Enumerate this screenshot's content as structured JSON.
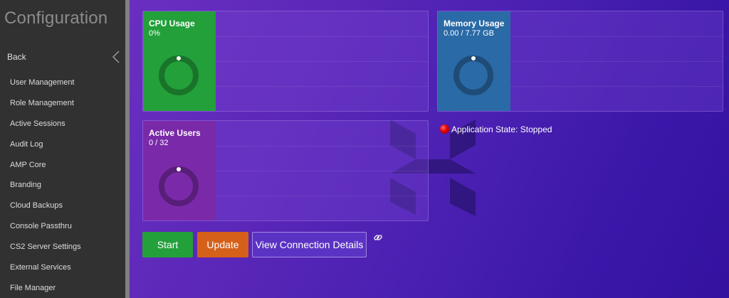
{
  "sidebar": {
    "title": "Configuration",
    "back_label": "Back",
    "items": [
      {
        "label": "User Management"
      },
      {
        "label": "Role Management"
      },
      {
        "label": "Active Sessions"
      },
      {
        "label": "Audit Log"
      },
      {
        "label": "AMP Core"
      },
      {
        "label": "Branding"
      },
      {
        "label": "Cloud Backups"
      },
      {
        "label": "Console Passthru"
      },
      {
        "label": "CS2 Server Settings"
      },
      {
        "label": "External Services"
      },
      {
        "label": "File Manager"
      }
    ]
  },
  "metrics": {
    "cpu": {
      "title": "CPU Usage",
      "value": "0%",
      "fraction": 0,
      "color": "#23a03a"
    },
    "memory": {
      "title": "Memory Usage",
      "value": "0.00 / 7.77 GB",
      "fraction": 0,
      "color": "#2a6aa6"
    },
    "users": {
      "title": "Active Users",
      "value": "0 / 32",
      "fraction": 0,
      "color": "#7a2aa8"
    }
  },
  "app_state": {
    "text": "Application State: Stopped",
    "color": "#e00000"
  },
  "actions": {
    "start_label": "Start",
    "update_label": "Update",
    "view_label": "View Connection Details"
  },
  "icons": {
    "back": "chevron-left-icon",
    "link": "link-icon",
    "logo": "brand-logo"
  },
  "colors": {
    "sidebar_bg": "#313131",
    "start": "#23a03a",
    "update": "#d5601a",
    "view": "#5b33c4"
  }
}
